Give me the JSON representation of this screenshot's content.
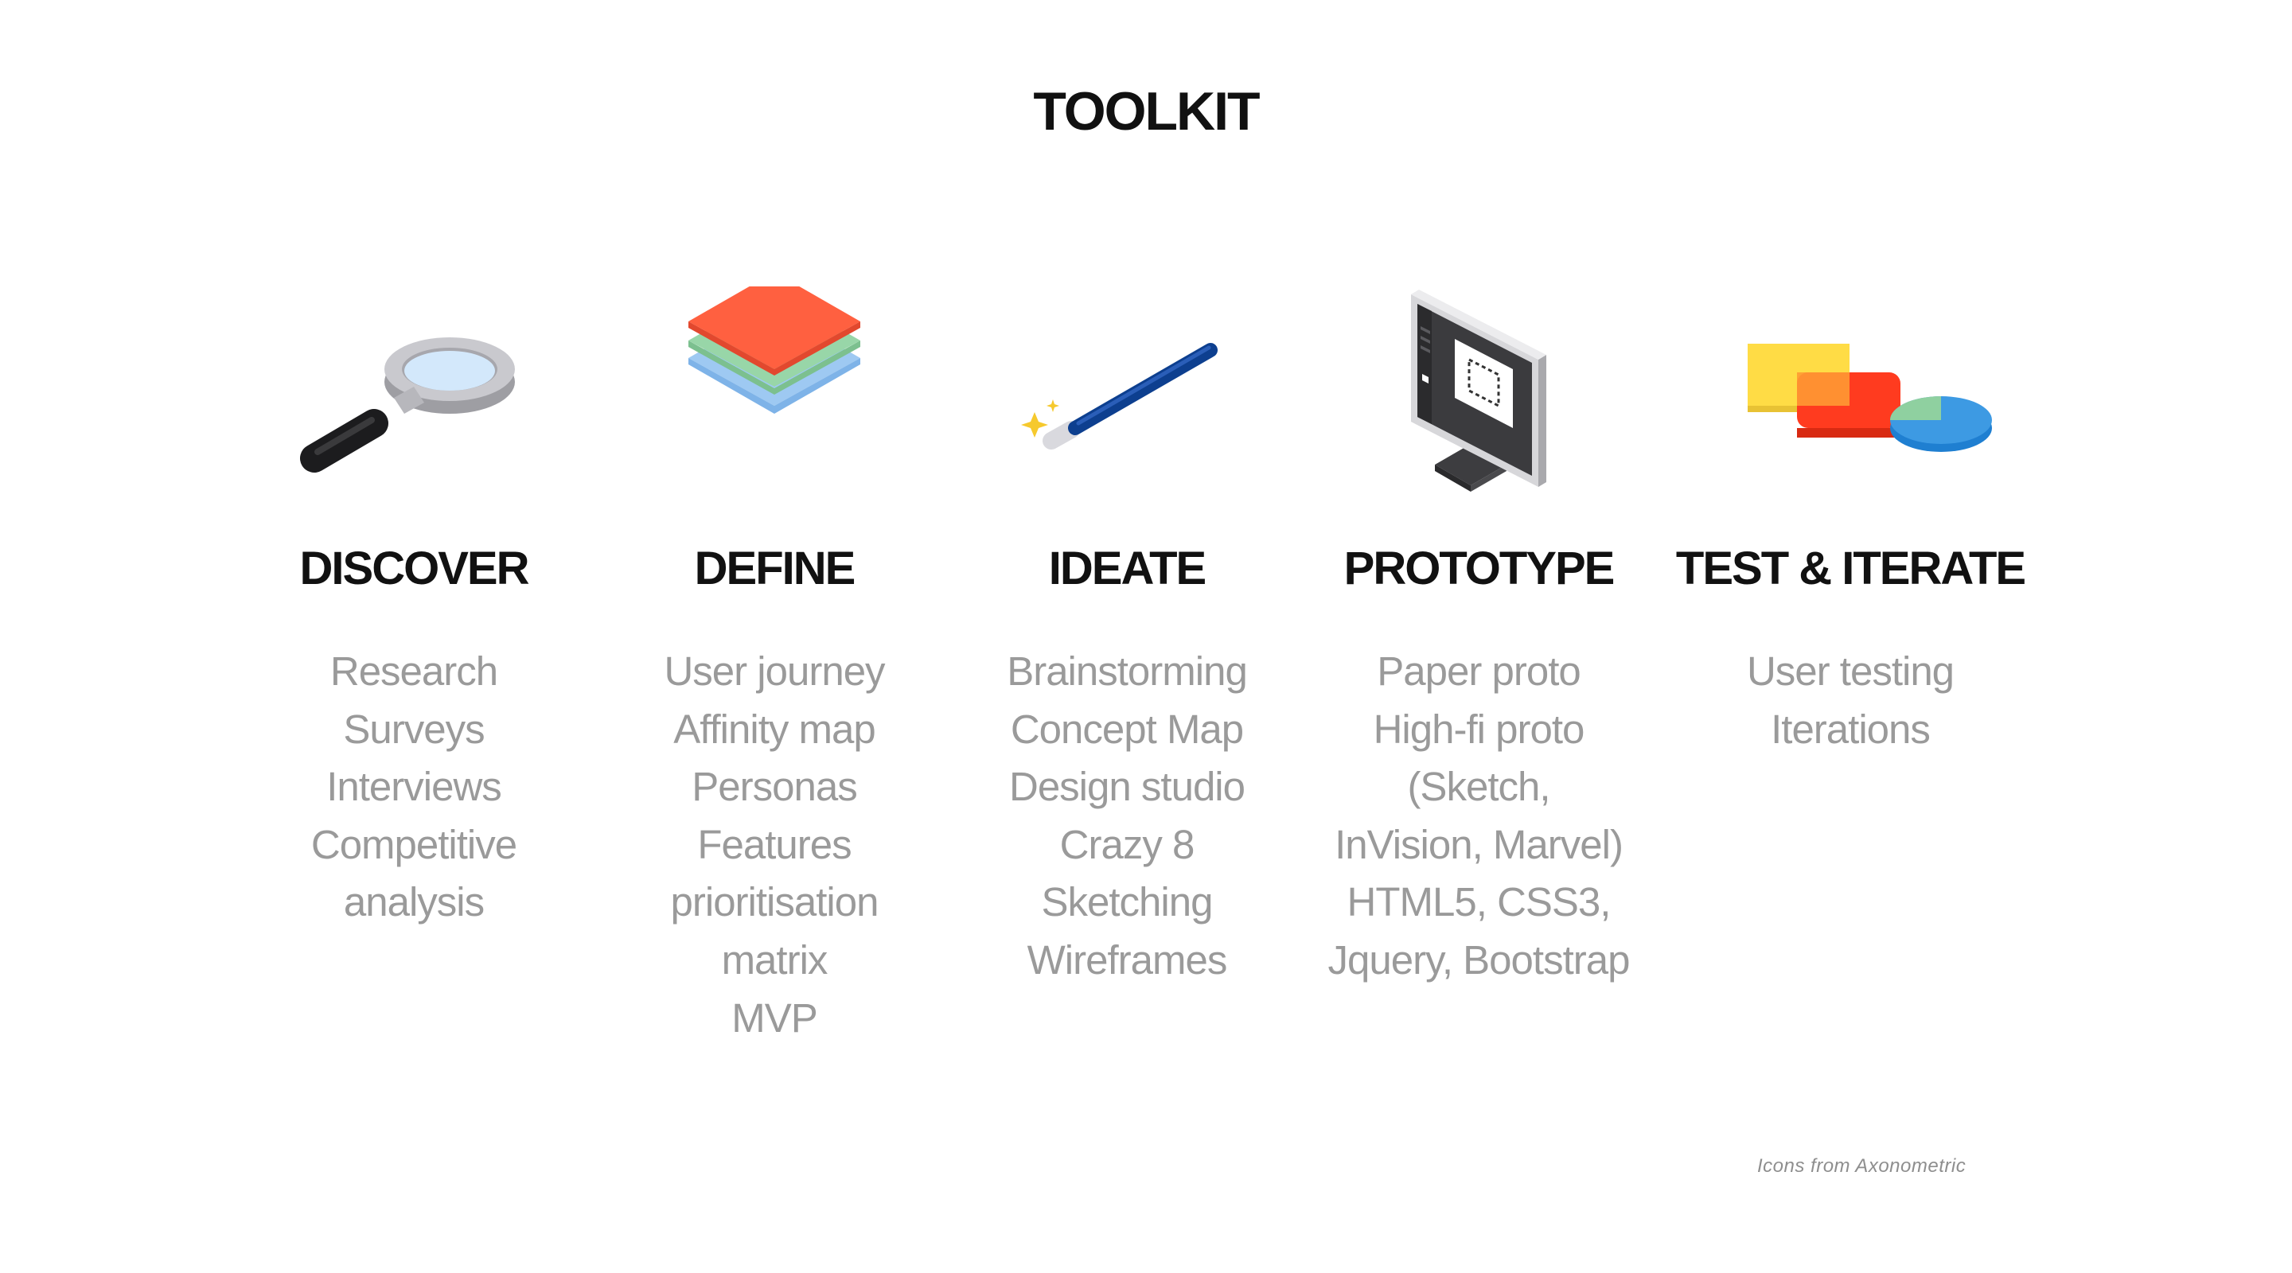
{
  "title": "TOOLKIT",
  "columns": [
    {
      "heading": "DISCOVER",
      "icon": "magnifying-glass-icon",
      "items": [
        "Research",
        "Surveys",
        "Interviews",
        "Competitive",
        "analysis"
      ]
    },
    {
      "heading": "DEFINE",
      "icon": "layers-icon",
      "items": [
        "User journey",
        "Affinity map",
        "Personas",
        "Features",
        "prioritisation",
        "matrix",
        "MVP"
      ]
    },
    {
      "heading": "IDEATE",
      "icon": "magic-wand-icon",
      "items": [
        "Brainstorming",
        "Concept Map",
        "Design studio",
        "Crazy 8",
        "Sketching",
        "Wireframes"
      ]
    },
    {
      "heading": "PROTOTYPE",
      "icon": "monitor-icon",
      "items": [
        "Paper proto",
        "High-fi proto",
        "(Sketch,",
        "InVision, Marvel)",
        "HTML5, CSS3,",
        "Jquery, Bootstrap"
      ]
    },
    {
      "heading": "TEST & ITERATE",
      "icon": "shapes-icon",
      "items": [
        "User testing",
        "Iterations"
      ]
    }
  ],
  "credit": "Icons from Axonometric",
  "colors": {
    "heading": "#111111",
    "item_text": "#9a9a9a",
    "credit_text": "#8e8e8e"
  }
}
